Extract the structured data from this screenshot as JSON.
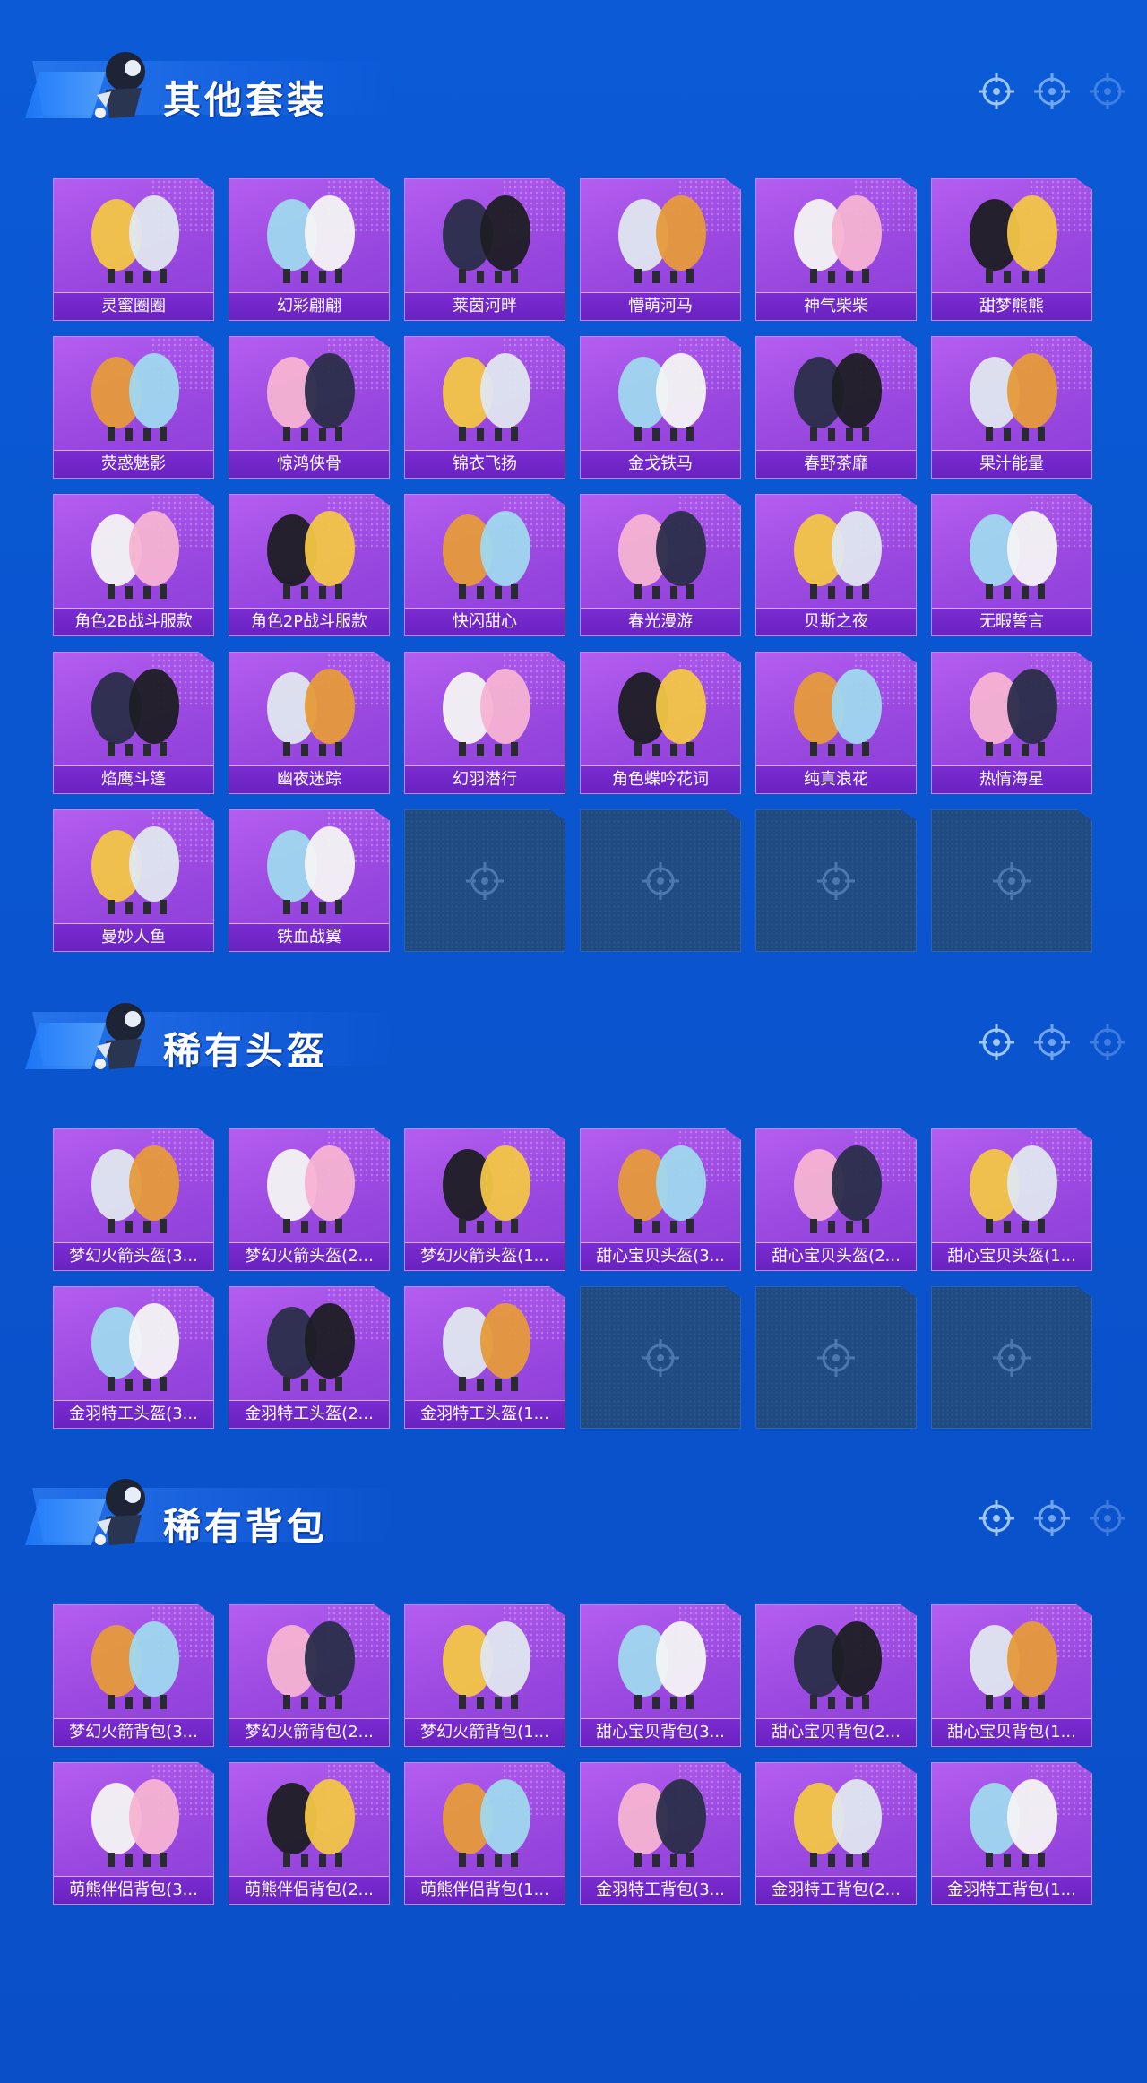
{
  "sections": [
    {
      "title": "其他套装",
      "items": [
        "灵蜜圈圈",
        "幻彩翩翩",
        "莱茵河畔",
        "懵萌河马",
        "神气柴柴",
        "甜梦熊熊",
        "荧惑魅影",
        "惊鸿侠骨",
        "锦衣飞扬",
        "金戈铁马",
        "春野茶靡",
        "果汁能量",
        "角色2B战斗服款",
        "角色2P战斗服款",
        "快闪甜心",
        "春光漫游",
        "贝斯之夜",
        "无暇誓言",
        "焰鹰斗篷",
        "幽夜迷踪",
        "幻羽潜行",
        "角色蝶吟花词",
        "纯真浪花",
        "热情海星",
        "曼妙人鱼",
        "铁血战翼"
      ],
      "empty_slots": 4
    },
    {
      "title": "稀有头盔",
      "items": [
        "梦幻火箭头盔(3...",
        "梦幻火箭头盔(2...",
        "梦幻火箭头盔(1...",
        "甜心宝贝头盔(3...",
        "甜心宝贝头盔(2...",
        "甜心宝贝头盔(1...",
        "金羽特工头盔(3...",
        "金羽特工头盔(2...",
        "金羽特工头盔(1..."
      ],
      "empty_slots": 3
    },
    {
      "title": "稀有背包",
      "items": [
        "梦幻火箭背包(3...",
        "梦幻火箭背包(2...",
        "梦幻火箭背包(1...",
        "甜心宝贝背包(3...",
        "甜心宝贝背包(2...",
        "甜心宝贝背包(1...",
        "萌熊伴侣背包(3...",
        "萌熊伴侣背包(2...",
        "萌熊伴侣背包(1...",
        "金羽特工背包(3...",
        "金羽特工背包(2...",
        "金羽特工背包(1..."
      ],
      "empty_slots": 0
    }
  ],
  "colors": {
    "card": "#9a48e0",
    "label": "#6a22c2",
    "empty": "#1f4a82",
    "background": "#0a55d0"
  },
  "icons": {
    "header": "crosshair-icon",
    "empty_slot": "crosshair-icon",
    "mascot": "mascot-icon"
  }
}
